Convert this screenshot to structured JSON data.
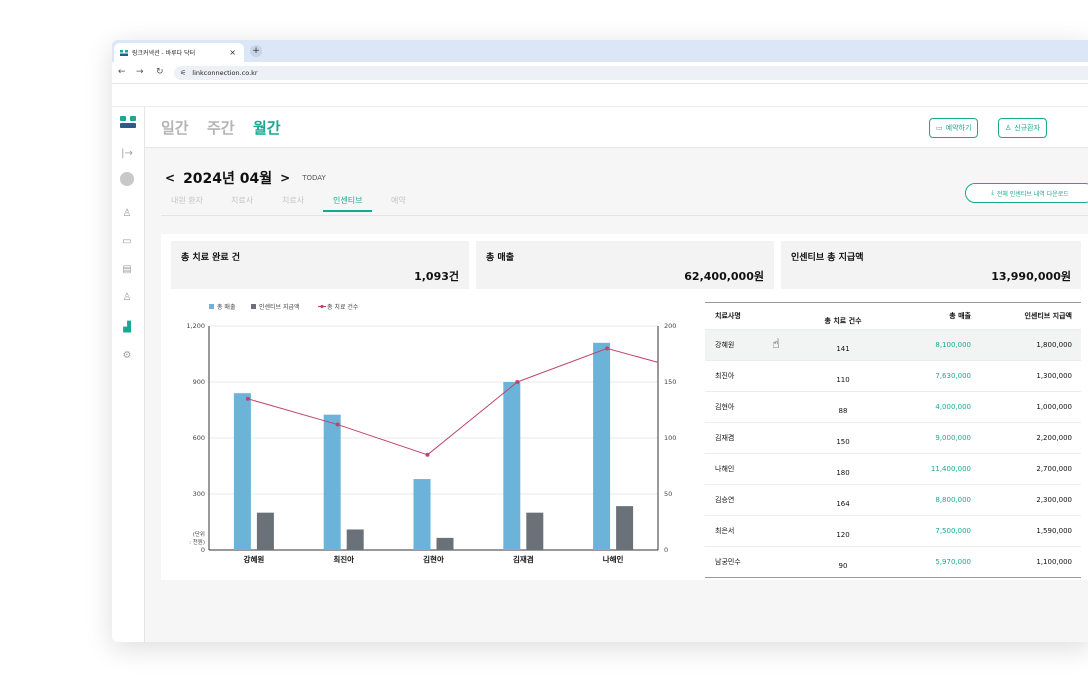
{
  "browser": {
    "tab_title": "링크커넥션 - 바루다 닥터",
    "tab_close": "×",
    "new_tab": "+",
    "url": "linkconnection.co.kr"
  },
  "header": {
    "view_tabs": [
      {
        "label": "일간"
      },
      {
        "label": "주간"
      },
      {
        "label": "월간"
      }
    ],
    "reserve_button": "예약하기",
    "new_patient_button": "신규환자"
  },
  "period": {
    "prev": "<",
    "label": "2024년 04월",
    "next": ">",
    "today": "TODAY"
  },
  "subtabs": [
    {
      "label": "내원 환자"
    },
    {
      "label": "치료사"
    },
    {
      "label": "치료사"
    },
    {
      "label": "인센티브"
    },
    {
      "label": "예약"
    }
  ],
  "download_button": "전체 인센티브 내역 다운로드",
  "stats": [
    {
      "title": "총 치료 완료 건",
      "value": "1,093건"
    },
    {
      "title": "총 매출",
      "value": "62,400,000원"
    },
    {
      "title": "인센티브 총 지급액",
      "value": "13,990,000원"
    }
  ],
  "chart_data": {
    "type": "bar",
    "categories": [
      "강혜원",
      "최진아",
      "김현아",
      "김재겸",
      "나해인"
    ],
    "series": [
      {
        "name": "총 매출",
        "type": "bar",
        "axis": "left",
        "color": "#6bb3d9",
        "values": [
          840,
          725,
          380,
          900,
          1110
        ]
      },
      {
        "name": "인센티브 지급액",
        "type": "bar",
        "axis": "left",
        "color": "#6b7178",
        "values": [
          200,
          110,
          65,
          200,
          235
        ]
      },
      {
        "name": "총 치료 건수",
        "type": "line",
        "axis": "right",
        "color": "#c1446f",
        "values": [
          135,
          112,
          85,
          150,
          180
        ]
      }
    ],
    "left_ticks": [
      "1,200",
      "900",
      "600",
      "300",
      "0"
    ],
    "right_ticks": [
      "200",
      "150",
      "100",
      "50",
      "0"
    ],
    "ylim_left": [
      0,
      1200
    ],
    "ylim_right": [
      0,
      200
    ],
    "unit_note": [
      "(단위",
      ": 천원)"
    ],
    "grid": true,
    "legend": "top-left"
  },
  "table": {
    "headers": [
      "치료사명",
      "총 치료 건수",
      "총 매출",
      "인센티브 지급액"
    ],
    "rows": [
      [
        "강혜원",
        "141",
        "8,100,000",
        "1,800,000"
      ],
      [
        "최진아",
        "110",
        "7,630,000",
        "1,300,000"
      ],
      [
        "김현아",
        "88",
        "4,000,000",
        "1,000,000"
      ],
      [
        "김재겸",
        "150",
        "9,000,000",
        "2,200,000"
      ],
      [
        "나해인",
        "180",
        "11,400,000",
        "2,700,000"
      ],
      [
        "김승연",
        "164",
        "8,800,000",
        "2,300,000"
      ],
      [
        "최은서",
        "120",
        "7,500,000",
        "1,590,000"
      ],
      [
        "남궁민수",
        "90",
        "5,970,000",
        "1,100,000"
      ]
    ]
  },
  "colors": {
    "accent": "#1aa891",
    "bar_revenue": "#6bb3d9",
    "bar_incentive": "#6b7178",
    "line": "#c1446f"
  }
}
